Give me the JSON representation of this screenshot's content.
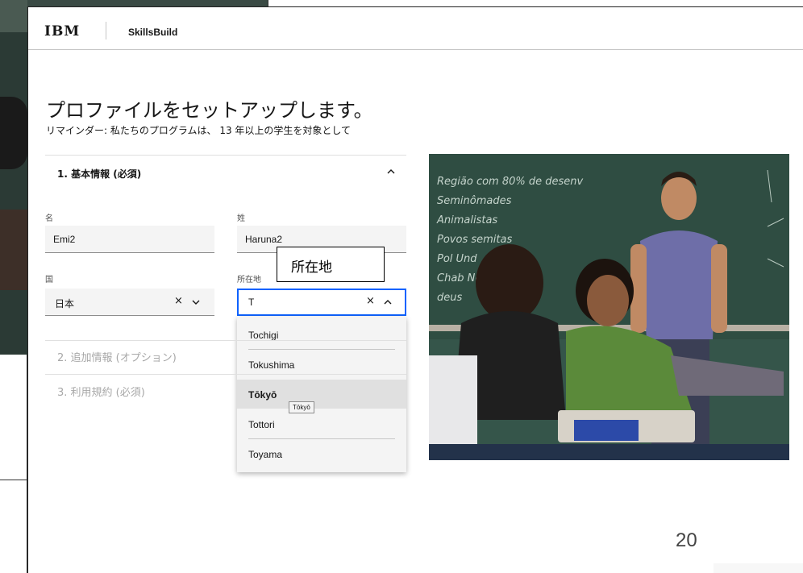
{
  "header": {
    "logo": "IBM",
    "product": "SkillsBuild"
  },
  "page": {
    "title": "プロファイルをセットアップします。",
    "subtitle": "リマインダー: 私たちのプログラムは、 13 年以上の学生を対象として"
  },
  "sections": [
    {
      "label": "1. 基本情報 (必須)",
      "expanded": true
    },
    {
      "label": "2. 追加情報 (オプション)",
      "expanded": false
    },
    {
      "label": "3. 利用規約 (必須)",
      "expanded": false
    }
  ],
  "fields": {
    "first_name": {
      "label": "名",
      "value": "Emi2"
    },
    "last_name": {
      "label": "姓",
      "value": "Haruna2"
    },
    "country": {
      "label": "国",
      "value": "日本"
    },
    "location": {
      "label": "所在地",
      "value": "T"
    }
  },
  "dropdown": {
    "options": [
      "Tochigi",
      "Tokushima",
      "Tōkyō",
      "Tottori",
      "Toyama"
    ],
    "hovered_index": 2,
    "tooltip": "Tōkyō"
  },
  "callout": {
    "text": "所在地"
  },
  "slide": {
    "page_number": "20"
  },
  "photo": {
    "chalkboard_text": [
      "Região com 80% de desenv",
      "Seminômades",
      "Animalistas",
      "Povos semitas",
      "Pol Und",
      "Chab Ne",
      "deus"
    ]
  },
  "colors": {
    "focus_border": "#0f62fe",
    "field_bg": "#f4f4f4",
    "disabled_text": "#a8a8a8",
    "chalkboard": "#2f4a3e"
  },
  "icons": {
    "clear": "close-icon",
    "expand": "chevron-down-icon",
    "collapse": "chevron-up-icon"
  }
}
